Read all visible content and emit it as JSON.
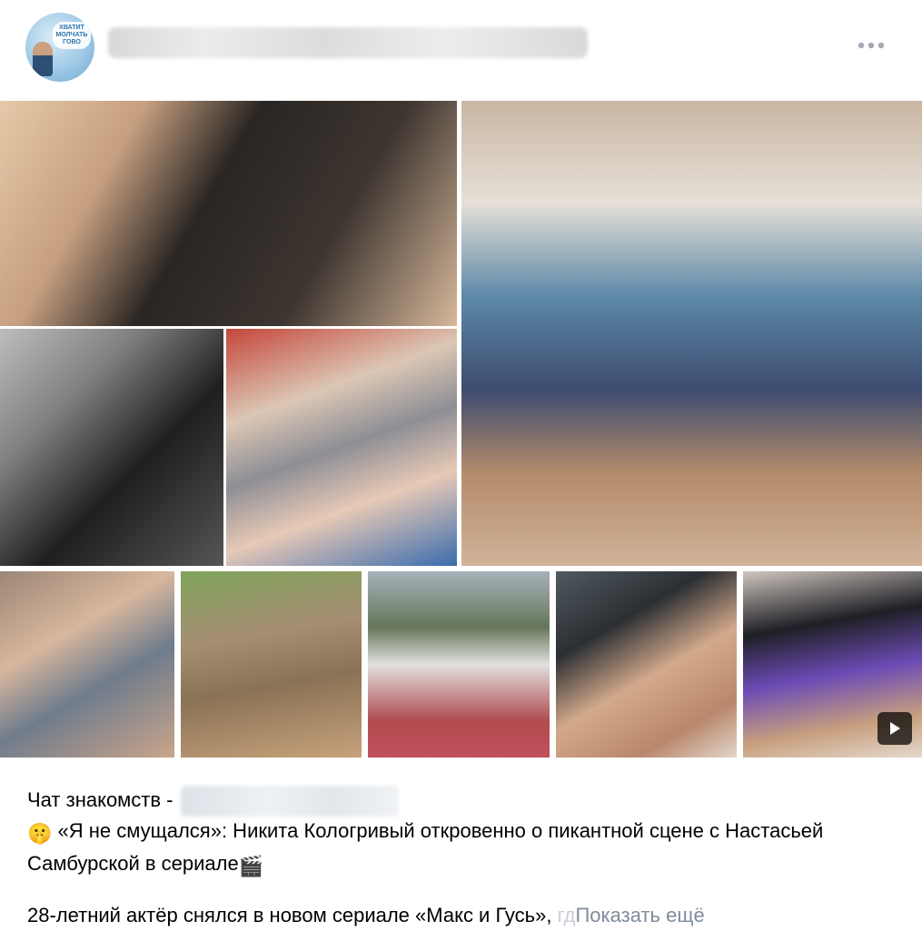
{
  "header": {
    "avatar_text": "ХВАТИТ МОЛЧАТЬ ГОВО",
    "more_icon": "ellipsis-horizontal-icon"
  },
  "photos": {
    "play_icon": "play-icon"
  },
  "post": {
    "line1_prefix": "Чат знакомств -",
    "title_emoji_start": "🤫",
    "title": "«Я не смущался»: Никита Кологривый откровенно о пикантной сцене с Настасьей Самбурской в сериале",
    "title_emoji_end": "🎬",
    "body_text": "28-летний актёр снялся в новом сериале «Макс и Гусь»,",
    "body_fade": "гд",
    "show_more": "Показать ещё"
  },
  "colors": {
    "link_muted": "#7f8c9c",
    "text": "#000000"
  }
}
